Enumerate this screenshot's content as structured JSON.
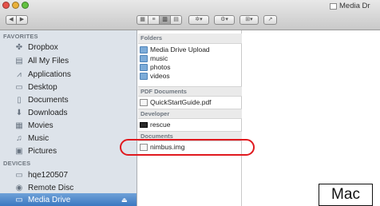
{
  "window": {
    "title": "Media Dr"
  },
  "toolbar": {
    "back_glyph": "◀",
    "forward_glyph": "▶",
    "view_glyphs": [
      "▦",
      "≡",
      "▥",
      "▤"
    ],
    "action_glyph": "✲▾",
    "share_glyph": "⚙▾",
    "arrange_glyph": "⊞▾",
    "edit_glyph": "↗"
  },
  "sidebar": {
    "favorites_heading": "FAVORITES",
    "favorites": [
      {
        "label": "Dropbox",
        "icon": "dropbox-icon",
        "glyph": "✤"
      },
      {
        "label": "All My Files",
        "icon": "all-files-icon",
        "glyph": "▤"
      },
      {
        "label": "Applications",
        "icon": "applications-icon",
        "glyph": "⩘"
      },
      {
        "label": "Desktop",
        "icon": "desktop-icon",
        "glyph": "▭"
      },
      {
        "label": "Documents",
        "icon": "documents-icon",
        "glyph": "▯"
      },
      {
        "label": "Downloads",
        "icon": "downloads-icon",
        "glyph": "⬇"
      },
      {
        "label": "Movies",
        "icon": "movies-icon",
        "glyph": "▦"
      },
      {
        "label": "Music",
        "icon": "music-icon",
        "glyph": "♫"
      },
      {
        "label": "Pictures",
        "icon": "pictures-icon",
        "glyph": "▣"
      }
    ],
    "devices_heading": "DEVICES",
    "devices": [
      {
        "label": "hqe120507",
        "icon": "computer-icon",
        "glyph": "▭"
      },
      {
        "label": "Remote Disc",
        "icon": "remote-disc-icon",
        "glyph": "◉"
      },
      {
        "label": "Media Drive",
        "icon": "drive-icon",
        "glyph": "▭",
        "eject": "⏏"
      }
    ]
  },
  "column": {
    "groups": [
      {
        "heading": "Folders",
        "items": [
          "Media Drive Upload",
          "music",
          "photos",
          "videos"
        ]
      },
      {
        "heading": "PDF Documents",
        "items": [
          "QuickStartGuide.pdf"
        ]
      },
      {
        "heading": "Developer",
        "items": [
          "rescue"
        ]
      },
      {
        "heading": "Documents",
        "items": [
          "nimbus.img"
        ]
      }
    ]
  },
  "annotation": {
    "platform_label": "Mac",
    "highlight_color": "#e0191e"
  }
}
